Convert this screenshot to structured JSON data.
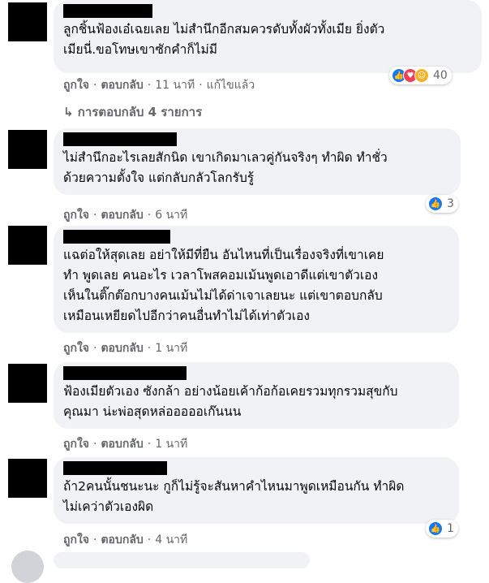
{
  "comments": [
    {
      "text": "ลูกชิ้นฟ้องเอ๋เฉยเลย ไม่สำนึกอีกสมควรดับทั้งผัวทั้งเมีย ยิ่งตัว\nเมียนี่.ขอโทษเขาซักคำก็ไม่มี",
      "like": "ถูกใจ",
      "reply": "ตอบกลับ",
      "time": "11 นาที",
      "edited": "แก้ไขแล้ว",
      "reaction_count": "40",
      "reaction_icons": [
        "like-icon",
        "love-icon",
        "haha-icon"
      ],
      "view_replies": "↳ การตอบกลับ 4 รายการ"
    },
    {
      "text": "ไม่สำนึกอะไรเลยสักนิด เขาเกิดมาเลวคู่กันจริงๆ ทำผิด ทำชั่ว\nด้วยความตั้งใจ แต่กลับกลัวโลกรับรู้",
      "like": "ถูกใจ",
      "reply": "ตอบกลับ",
      "time": "6 นาที",
      "reaction_count": "3",
      "reaction_icons": [
        "like-icon"
      ]
    },
    {
      "text": "แฉต่อให้สุดเลย อย่าให้มีที่ยืน อันไหนที่เป็นเรื่องจริงที่เขาเคย\nทำ พูดเลย คนอะไร เวลาโพสคอมเม้นพูดเอาดีแต่เขาตัวเอง\nเห็นในติ๊กต๊อกบางคนเม้นไม่ได้ด่าเจาเลยนะ แต่เขาตอบกลับ\nเหมือนเหยียดไปอีกว่าคนอื่นทำไม่ได้เท่าตัวเอง",
      "like": "ถูกใจ",
      "reply": "ตอบกลับ",
      "time": "1 นาที"
    },
    {
      "text": "ฟ้องเมียตัวเอง ซังกล้า อย่างน้อยเค้าก้อก้อเคยรวมทุกรวมสุขกับ\nคุณมา น่ะพ่อสุดหล่อออออเก๊นนน",
      "like": "ถูกใจ",
      "reply": "ตอบกลับ",
      "time": "1 นาที"
    },
    {
      "text": "ถ้า2คนนั้นชนะนะ กูก็ไม่รู้จะสันหาคำไหนมาพูดเหมือนกัน ทำผิด\nไม่เคว่าตัวเองผิด",
      "like": "ถูกใจ",
      "reply": "ตอบกลับ",
      "time": "4 นาที",
      "reaction_count": "1",
      "reaction_icons": [
        "like-icon"
      ]
    }
  ],
  "colors": {
    "bubble": "#f0f2f5",
    "meta_text": "#65676b",
    "like_blue": "#1877f2",
    "love_red": "#f33e58",
    "haha_yellow": "#f7b125"
  }
}
